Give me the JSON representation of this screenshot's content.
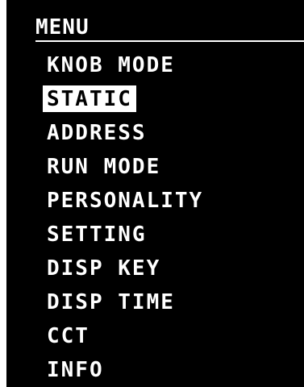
{
  "menu": {
    "title": "MENU",
    "selected_index": 1,
    "items": [
      {
        "label": "KNOB MODE"
      },
      {
        "label": "STATIC"
      },
      {
        "label": "ADDRESS"
      },
      {
        "label": "RUN MODE"
      },
      {
        "label": "PERSONALITY"
      },
      {
        "label": "SETTING"
      },
      {
        "label": "DISP KEY"
      },
      {
        "label": "DISP TIME"
      },
      {
        "label": "CCT"
      },
      {
        "label": "INFO"
      }
    ]
  },
  "colors": {
    "background": "#000000",
    "text": "#ffffff",
    "highlight_bg": "#ffffff",
    "highlight_text": "#000000"
  }
}
